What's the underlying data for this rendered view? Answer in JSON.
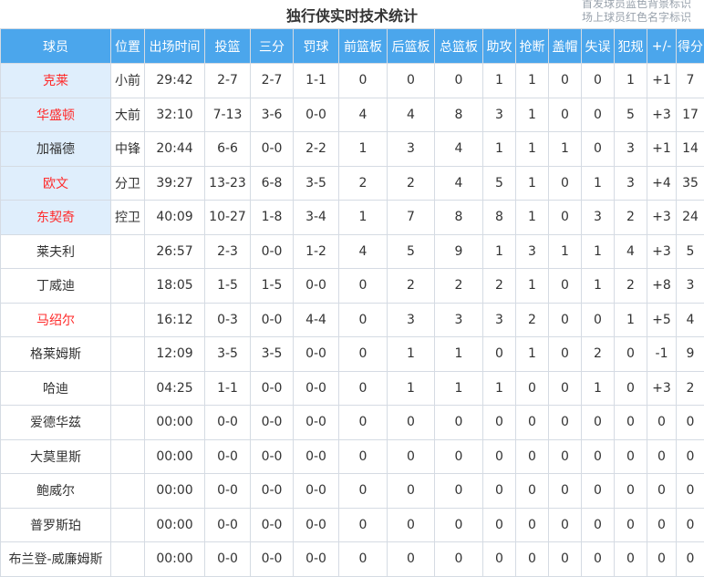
{
  "title": "独行侠实时技术统计",
  "legend": [
    "首发球员蓝色背景标识",
    "场上球员红色名字标识"
  ],
  "colors": {
    "header_bg": "#4ba6ec",
    "starter_bg": "#dfeefc",
    "on_court_name": "#ff2b2b"
  },
  "columns": [
    "球员",
    "位置",
    "出场时间",
    "投篮",
    "三分",
    "罚球",
    "前篮板",
    "后篮板",
    "总篮板",
    "助攻",
    "抢断",
    "盖帽",
    "失误",
    "犯规",
    "+/-",
    "得分"
  ],
  "players": [
    {
      "name": "克莱",
      "pos": "小前",
      "starter": true,
      "on_court": true,
      "stats": [
        "29:42",
        "2-7",
        "2-7",
        "1-1",
        "0",
        "0",
        "0",
        "1",
        "1",
        "0",
        "0",
        "1",
        "+1",
        "7"
      ]
    },
    {
      "name": "华盛顿",
      "pos": "大前",
      "starter": true,
      "on_court": true,
      "stats": [
        "32:10",
        "7-13",
        "3-6",
        "0-0",
        "4",
        "4",
        "8",
        "3",
        "1",
        "0",
        "0",
        "5",
        "+3",
        "17"
      ]
    },
    {
      "name": "加福德",
      "pos": "中锋",
      "starter": true,
      "on_court": false,
      "stats": [
        "20:44",
        "6-6",
        "0-0",
        "2-2",
        "1",
        "3",
        "4",
        "1",
        "1",
        "1",
        "0",
        "3",
        "+1",
        "14"
      ]
    },
    {
      "name": "欧文",
      "pos": "分卫",
      "starter": true,
      "on_court": true,
      "stats": [
        "39:27",
        "13-23",
        "6-8",
        "3-5",
        "2",
        "2",
        "4",
        "5",
        "1",
        "0",
        "1",
        "3",
        "+4",
        "35"
      ]
    },
    {
      "name": "东契奇",
      "pos": "控卫",
      "starter": true,
      "on_court": true,
      "stats": [
        "40:09",
        "10-27",
        "1-8",
        "3-4",
        "1",
        "7",
        "8",
        "8",
        "1",
        "0",
        "3",
        "2",
        "+3",
        "24"
      ]
    },
    {
      "name": "莱夫利",
      "pos": "",
      "starter": false,
      "on_court": false,
      "stats": [
        "26:57",
        "2-3",
        "0-0",
        "1-2",
        "4",
        "5",
        "9",
        "1",
        "3",
        "1",
        "1",
        "4",
        "+3",
        "5"
      ]
    },
    {
      "name": "丁威迪",
      "pos": "",
      "starter": false,
      "on_court": false,
      "stats": [
        "18:05",
        "1-5",
        "1-5",
        "0-0",
        "0",
        "2",
        "2",
        "2",
        "1",
        "0",
        "1",
        "2",
        "+8",
        "3"
      ]
    },
    {
      "name": "马绍尔",
      "pos": "",
      "starter": false,
      "on_court": true,
      "stats": [
        "16:12",
        "0-3",
        "0-0",
        "4-4",
        "0",
        "3",
        "3",
        "3",
        "2",
        "0",
        "0",
        "1",
        "+5",
        "4"
      ]
    },
    {
      "name": "格莱姆斯",
      "pos": "",
      "starter": false,
      "on_court": false,
      "stats": [
        "12:09",
        "3-5",
        "3-5",
        "0-0",
        "0",
        "1",
        "1",
        "0",
        "1",
        "0",
        "2",
        "0",
        "-1",
        "9"
      ]
    },
    {
      "name": "哈迪",
      "pos": "",
      "starter": false,
      "on_court": false,
      "stats": [
        "04:25",
        "1-1",
        "0-0",
        "0-0",
        "0",
        "1",
        "1",
        "1",
        "0",
        "0",
        "1",
        "0",
        "+3",
        "2"
      ]
    },
    {
      "name": "爱德华兹",
      "pos": "",
      "starter": false,
      "on_court": false,
      "stats": [
        "00:00",
        "0-0",
        "0-0",
        "0-0",
        "0",
        "0",
        "0",
        "0",
        "0",
        "0",
        "0",
        "0",
        "0",
        "0"
      ]
    },
    {
      "name": "大莫里斯",
      "pos": "",
      "starter": false,
      "on_court": false,
      "stats": [
        "00:00",
        "0-0",
        "0-0",
        "0-0",
        "0",
        "0",
        "0",
        "0",
        "0",
        "0",
        "0",
        "0",
        "0",
        "0"
      ]
    },
    {
      "name": "鲍威尔",
      "pos": "",
      "starter": false,
      "on_court": false,
      "stats": [
        "00:00",
        "0-0",
        "0-0",
        "0-0",
        "0",
        "0",
        "0",
        "0",
        "0",
        "0",
        "0",
        "0",
        "0",
        "0"
      ]
    },
    {
      "name": "普罗斯珀",
      "pos": "",
      "starter": false,
      "on_court": false,
      "stats": [
        "00:00",
        "0-0",
        "0-0",
        "0-0",
        "0",
        "0",
        "0",
        "0",
        "0",
        "0",
        "0",
        "0",
        "0",
        "0"
      ]
    },
    {
      "name": "布兰登-威廉姆斯",
      "pos": "",
      "starter": false,
      "on_court": false,
      "stats": [
        "00:00",
        "0-0",
        "0-0",
        "0-0",
        "0",
        "0",
        "0",
        "0",
        "0",
        "0",
        "0",
        "0",
        "0",
        "0"
      ]
    }
  ]
}
